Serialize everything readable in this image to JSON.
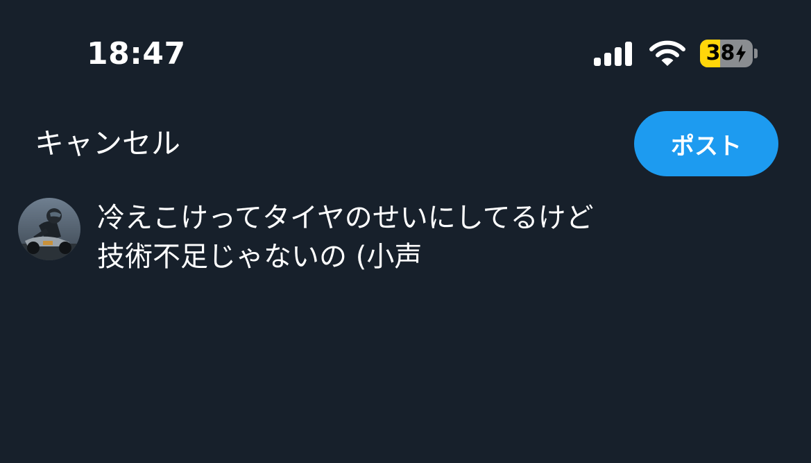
{
  "status_bar": {
    "time": "18:47",
    "battery_percent": "38",
    "battery_level": 0.38,
    "icons": [
      "signal-icon",
      "wifi-icon",
      "battery-charging-icon"
    ],
    "colors": {
      "battery_fill": "#ffd60a",
      "battery_body": "#8a8d91"
    }
  },
  "header": {
    "cancel_label": "キャンセル",
    "post_label": "ポスト"
  },
  "composer": {
    "avatar_icon": "user-avatar-motorcycle-rider",
    "text_lines": [
      "冷えこけってタイヤのせいにしてるけど",
      "技術不足じゃないの (小声"
    ]
  },
  "theme": {
    "background": "#17202b",
    "accent": "#1d9bf0",
    "text": "#ffffff"
  }
}
